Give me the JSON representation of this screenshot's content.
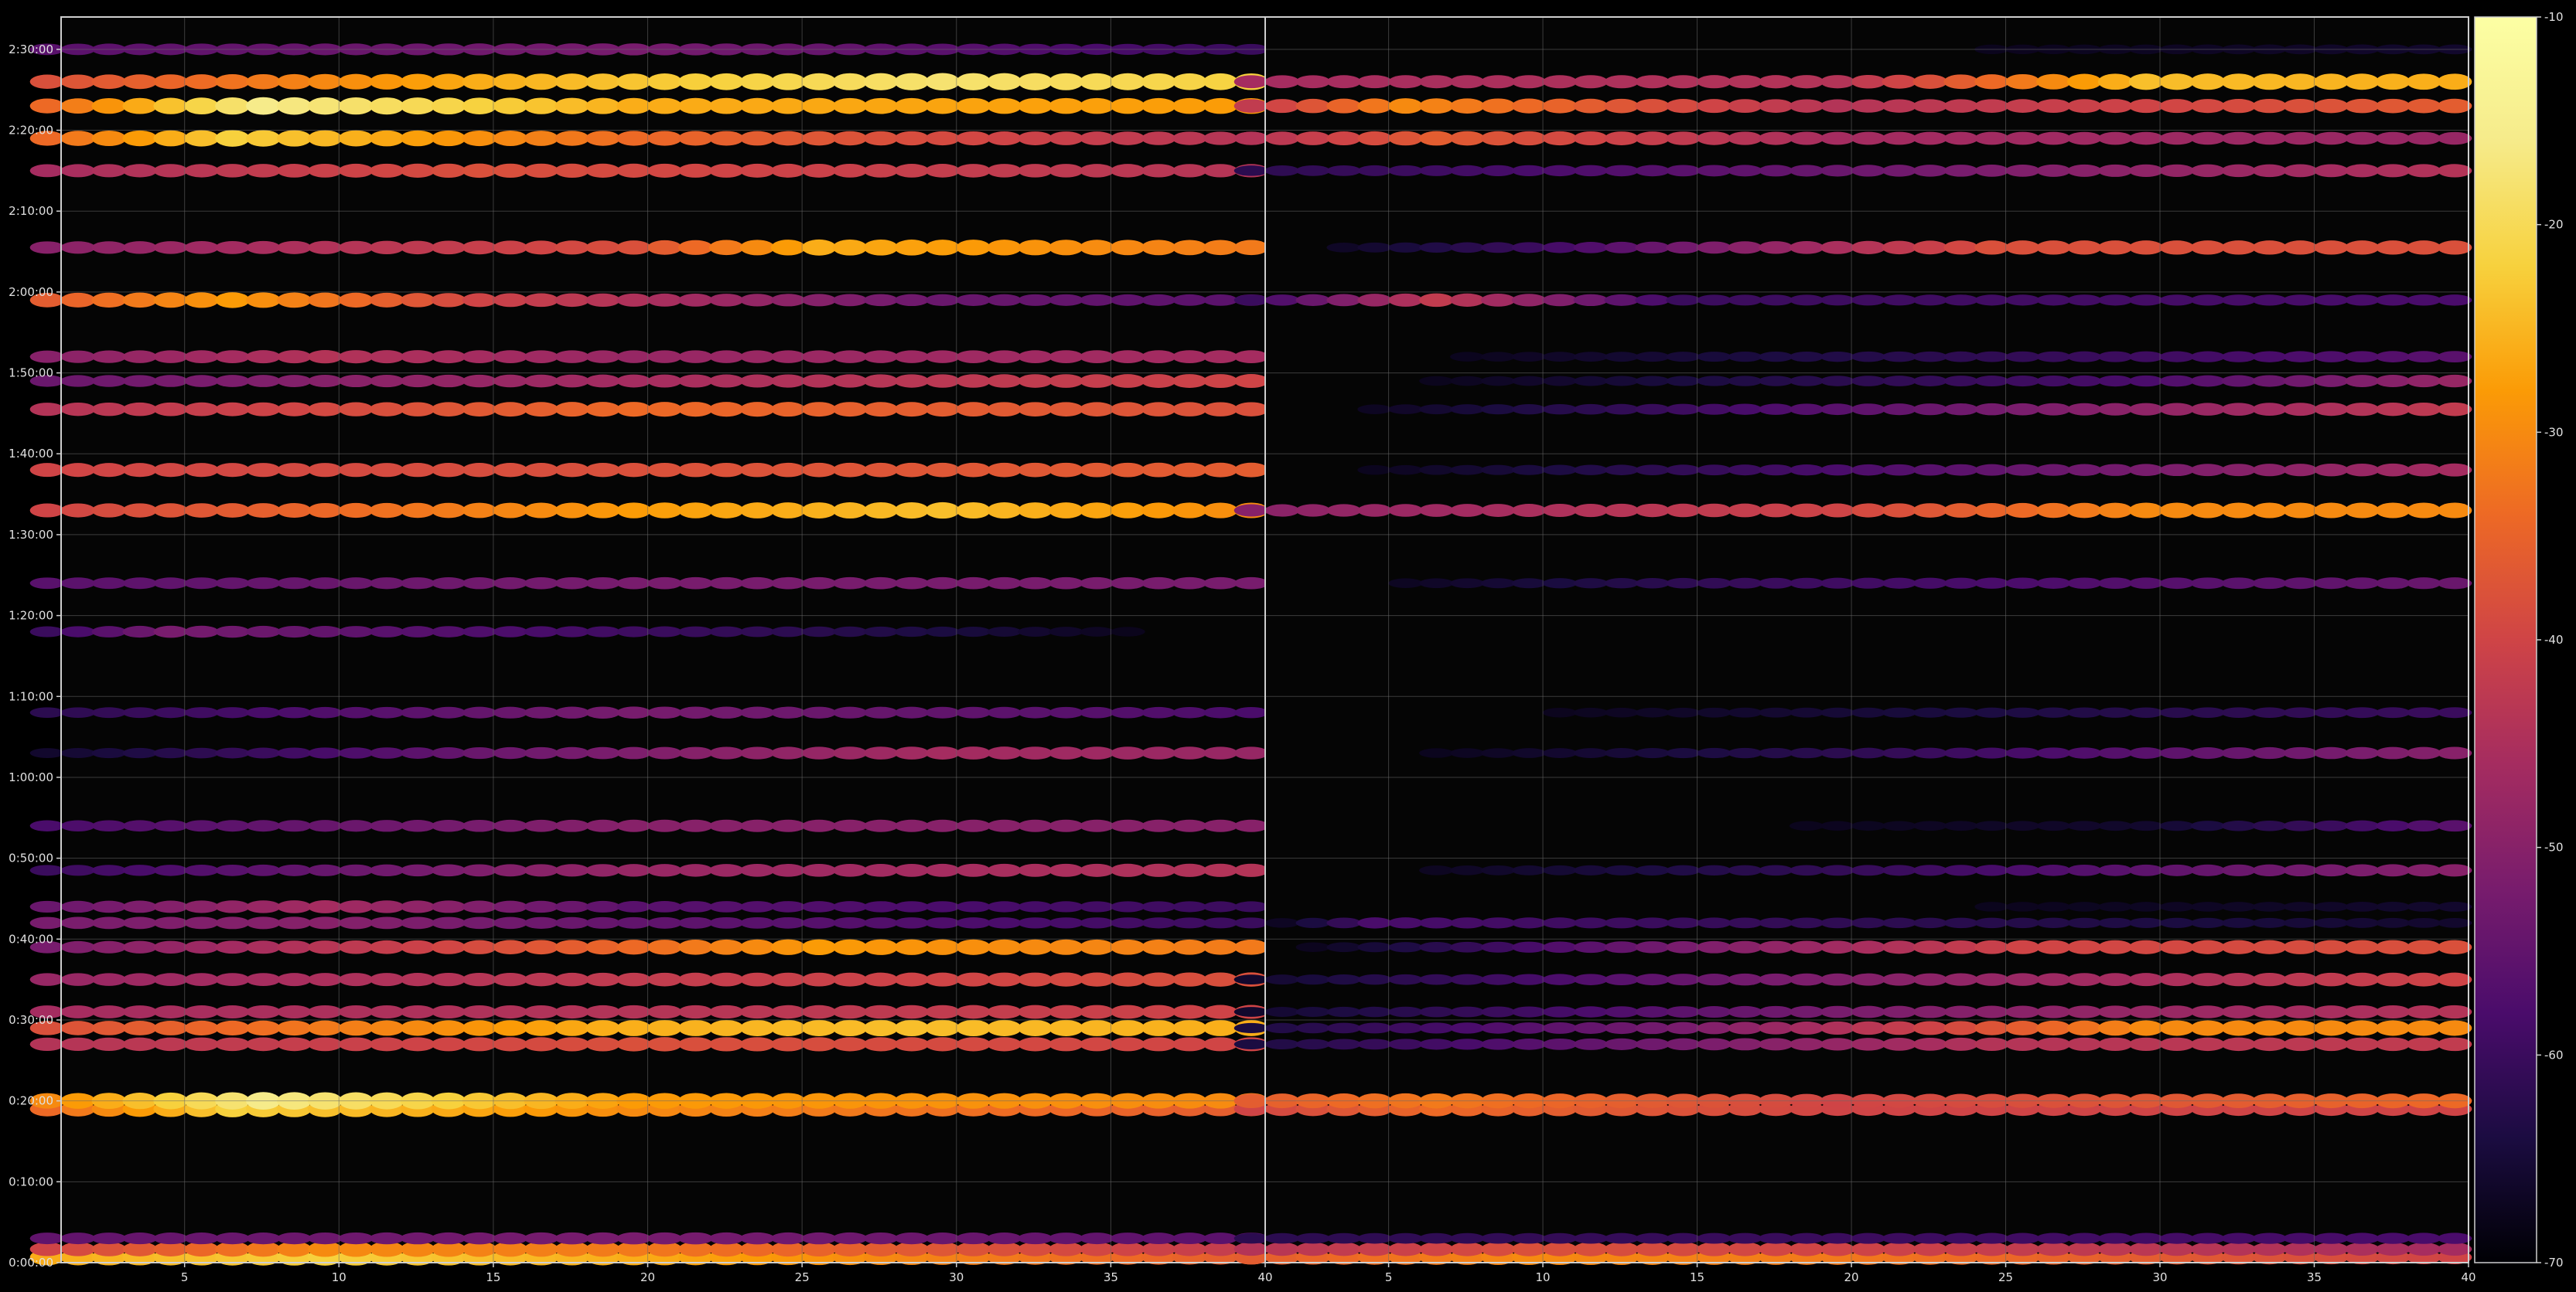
{
  "chart_data": {
    "type": "heatmap",
    "title": "",
    "xlabel": "",
    "ylabel": "",
    "grid": true,
    "colormap": "inferno",
    "x_range_per_panel": [
      1,
      40
    ],
    "y_range_seconds": [
      0,
      9240
    ],
    "panels": [
      {
        "name": "",
        "xticks": [
          "5",
          "10",
          "15",
          "20",
          "25",
          "30",
          "35",
          "40"
        ]
      },
      {
        "name": "",
        "xticks": [
          "5",
          "10",
          "15",
          "20",
          "25",
          "30",
          "35",
          "40"
        ]
      }
    ],
    "yticks": [
      "0:00:00",
      "0:10:00",
      "0:20:00",
      "0:30:00",
      "0:40:00",
      "0:50:00",
      "1:00:00",
      "1:10:00",
      "1:20:00",
      "1:30:00",
      "1:40:00",
      "1:50:00",
      "2:00:00",
      "2:10:00",
      "2:20:00",
      "2:30:00"
    ],
    "colorbar": {
      "range": [
        -70,
        -10
      ],
      "ticks": [
        "-70",
        "-60",
        "-50",
        "-40",
        "-30",
        "-20",
        "-10"
      ]
    },
    "bands": [
      {
        "t": 40,
        "p1": [
          [
            1,
            -26
          ],
          [
            10,
            -22
          ],
          [
            20,
            -26
          ],
          [
            40,
            -36
          ]
        ],
        "p2": [
          [
            1,
            -36
          ],
          [
            10,
            -30
          ],
          [
            20,
            -32
          ],
          [
            40,
            -40
          ]
        ]
      },
      {
        "t": 100,
        "p1": [
          [
            1,
            -40
          ],
          [
            10,
            -30
          ],
          [
            20,
            -32
          ],
          [
            40,
            -42
          ]
        ],
        "p2": [
          [
            1,
            -44
          ],
          [
            10,
            -38
          ],
          [
            20,
            -40
          ],
          [
            40,
            -46
          ]
        ]
      },
      {
        "t": 180,
        "p1": [
          [
            1,
            -55
          ],
          [
            20,
            -52
          ],
          [
            40,
            -56
          ]
        ],
        "p2": [
          [
            1,
            -62
          ],
          [
            40,
            -58
          ]
        ]
      },
      {
        "t": 1140,
        "p1": [
          [
            1,
            -34
          ],
          [
            7,
            -22
          ],
          [
            20,
            -30
          ],
          [
            40,
            -36
          ]
        ],
        "p2": [
          [
            1,
            -40
          ],
          [
            7,
            -34
          ],
          [
            20,
            -40
          ],
          [
            40,
            -40
          ]
        ]
      },
      {
        "t": 1200,
        "p1": [
          [
            1,
            -30
          ],
          [
            8,
            -16
          ],
          [
            20,
            -28
          ],
          [
            40,
            -30
          ]
        ],
        "p2": [
          [
            1,
            -36
          ],
          [
            7,
            -32
          ],
          [
            20,
            -40
          ],
          [
            40,
            -34
          ]
        ]
      },
      {
        "t": 1620,
        "p1": [
          [
            1,
            -44
          ],
          [
            20,
            -38
          ],
          [
            40,
            -40
          ]
        ],
        "p2": [
          [
            1,
            -64
          ],
          [
            25,
            -44
          ],
          [
            40,
            -42
          ]
        ]
      },
      {
        "t": 1740,
        "p1": [
          [
            1,
            -38
          ],
          [
            19,
            -26
          ],
          [
            29,
            -24
          ],
          [
            40,
            -26
          ]
        ],
        "p2": [
          [
            1,
            -64
          ],
          [
            15,
            -52
          ],
          [
            30,
            -30
          ],
          [
            40,
            -30
          ]
        ]
      },
      {
        "t": 1860,
        "p1": [
          [
            1,
            -46
          ],
          [
            20,
            -44
          ],
          [
            40,
            -40
          ]
        ],
        "p2": [
          [
            1,
            -66
          ],
          [
            20,
            -52
          ],
          [
            40,
            -44
          ]
        ]
      },
      {
        "t": 2100,
        "p1": [
          [
            1,
            -48
          ],
          [
            20,
            -42
          ],
          [
            40,
            -38
          ]
        ],
        "p2": [
          [
            1,
            -66
          ],
          [
            18,
            -52
          ],
          [
            40,
            -40
          ]
        ]
      },
      {
        "t": 2340,
        "p1": [
          [
            1,
            -52
          ],
          [
            20,
            -34
          ],
          [
            26,
            -28
          ],
          [
            40,
            -32
          ]
        ],
        "p2": [
          [
            1,
            -70
          ],
          [
            15,
            -52
          ],
          [
            26,
            -40
          ],
          [
            40,
            -38
          ]
        ]
      },
      {
        "t": 2520,
        "p1": [
          [
            1,
            -52
          ],
          [
            10,
            -50
          ],
          [
            20,
            -55
          ],
          [
            40,
            -60
          ]
        ],
        "p2": [
          [
            1,
            -70
          ],
          [
            5,
            -58
          ],
          [
            40,
            -66
          ]
        ]
      },
      {
        "t": 2640,
        "p1": [
          [
            1,
            -54
          ],
          [
            10,
            -46
          ],
          [
            20,
            -56
          ],
          [
            40,
            -60
          ]
        ],
        "p2": [
          [
            1,
            -70
          ],
          [
            40,
            -66
          ]
        ]
      },
      {
        "t": 2910,
        "p1": [
          [
            1,
            -60
          ],
          [
            20,
            -48
          ],
          [
            40,
            -44
          ]
        ],
        "p2": [
          [
            1,
            -70
          ],
          [
            22,
            -60
          ],
          [
            40,
            -50
          ]
        ]
      },
      {
        "t": 3240,
        "p1": [
          [
            1,
            -58
          ],
          [
            20,
            -50
          ],
          [
            40,
            -50
          ]
        ],
        "p2": [
          [
            1,
            -70
          ],
          [
            30,
            -66
          ],
          [
            40,
            -56
          ]
        ]
      },
      {
        "t": 3780,
        "p1": [
          [
            1,
            -66
          ],
          [
            15,
            -54
          ],
          [
            30,
            -46
          ],
          [
            40,
            -48
          ]
        ],
        "p2": [
          [
            1,
            -70
          ],
          [
            20,
            -62
          ],
          [
            40,
            -50
          ]
        ]
      },
      {
        "t": 4080,
        "p1": [
          [
            1,
            -62
          ],
          [
            20,
            -52
          ],
          [
            40,
            -58
          ]
        ],
        "p2": [
          [
            1,
            -70
          ],
          [
            40,
            -60
          ]
        ]
      },
      {
        "t": 4680,
        "p1": [
          [
            1,
            -60
          ],
          [
            5,
            -52
          ],
          [
            12,
            -56
          ],
          [
            30,
            -64
          ],
          [
            40,
            -70
          ]
        ],
        "p2": [
          [
            1,
            -70
          ],
          [
            40,
            -70
          ]
        ]
      },
      {
        "t": 5040,
        "p1": [
          [
            1,
            -56
          ],
          [
            20,
            -52
          ],
          [
            40,
            -52
          ]
        ],
        "p2": [
          [
            1,
            -70
          ],
          [
            18,
            -60
          ],
          [
            40,
            -54
          ]
        ]
      },
      {
        "t": 5580,
        "p1": [
          [
            1,
            -40
          ],
          [
            20,
            -28
          ],
          [
            30,
            -24
          ],
          [
            40,
            -30
          ]
        ],
        "p2": [
          [
            1,
            -50
          ],
          [
            20,
            -40
          ],
          [
            30,
            -30
          ],
          [
            40,
            -30
          ]
        ]
      },
      {
        "t": 5880,
        "p1": [
          [
            1,
            -40
          ],
          [
            20,
            -38
          ],
          [
            40,
            -36
          ]
        ],
        "p2": [
          [
            1,
            -70
          ],
          [
            20,
            -58
          ],
          [
            40,
            -46
          ]
        ]
      },
      {
        "t": 6330,
        "p1": [
          [
            1,
            -44
          ],
          [
            20,
            -34
          ],
          [
            40,
            -38
          ]
        ],
        "p2": [
          [
            1,
            -70
          ],
          [
            20,
            -56
          ],
          [
            40,
            -42
          ]
        ]
      },
      {
        "t": 6540,
        "p1": [
          [
            1,
            -54
          ],
          [
            20,
            -46
          ],
          [
            40,
            -40
          ]
        ],
        "p2": [
          [
            1,
            -70
          ],
          [
            30,
            -58
          ],
          [
            40,
            -48
          ]
        ]
      },
      {
        "t": 6720,
        "p1": [
          [
            1,
            -50
          ],
          [
            10,
            -44
          ],
          [
            20,
            -48
          ],
          [
            40,
            -46
          ]
        ],
        "p2": [
          [
            1,
            -70
          ],
          [
            40,
            -56
          ]
        ]
      },
      {
        "t": 7140,
        "p1": [
          [
            1,
            -36
          ],
          [
            7,
            -28
          ],
          [
            15,
            -40
          ],
          [
            30,
            -54
          ],
          [
            40,
            -56
          ]
        ],
        "p2": [
          [
            1,
            -60
          ],
          [
            7,
            -42
          ],
          [
            15,
            -60
          ],
          [
            40,
            -58
          ]
        ]
      },
      {
        "t": 7530,
        "p1": [
          [
            1,
            -50
          ],
          [
            20,
            -38
          ],
          [
            26,
            -26
          ],
          [
            40,
            -32
          ]
        ],
        "p2": [
          [
            1,
            -70
          ],
          [
            10,
            -60
          ],
          [
            25,
            -38
          ],
          [
            40,
            -38
          ]
        ]
      },
      {
        "t": 8100,
        "p1": [
          [
            1,
            -46
          ],
          [
            15,
            -38
          ],
          [
            40,
            -44
          ]
        ],
        "p2": [
          [
            1,
            -62
          ],
          [
            20,
            -54
          ],
          [
            40,
            -44
          ]
        ]
      },
      {
        "t": 8340,
        "p1": [
          [
            1,
            -34
          ],
          [
            7,
            -22
          ],
          [
            20,
            -34
          ],
          [
            40,
            -44
          ]
        ],
        "p2": [
          [
            1,
            -44
          ],
          [
            7,
            -36
          ],
          [
            20,
            -46
          ],
          [
            40,
            -48
          ]
        ]
      },
      {
        "t": 8580,
        "p1": [
          [
            1,
            -34
          ],
          [
            8,
            -16
          ],
          [
            20,
            -26
          ],
          [
            40,
            -28
          ]
        ],
        "p2": [
          [
            1,
            -42
          ],
          [
            6,
            -30
          ],
          [
            20,
            -44
          ],
          [
            40,
            -36
          ]
        ]
      },
      {
        "t": 8760,
        "p1": [
          [
            1,
            -38
          ],
          [
            15,
            -26
          ],
          [
            30,
            -18
          ],
          [
            40,
            -22
          ]
        ],
        "p2": [
          [
            1,
            -46
          ],
          [
            20,
            -44
          ],
          [
            30,
            -24
          ],
          [
            40,
            -26
          ]
        ]
      },
      {
        "t": 9000,
        "p1": [
          [
            1,
            -56
          ],
          [
            20,
            -52
          ],
          [
            40,
            -60
          ]
        ],
        "p2": [
          [
            1,
            -70
          ],
          [
            40,
            -66
          ]
        ]
      }
    ]
  }
}
